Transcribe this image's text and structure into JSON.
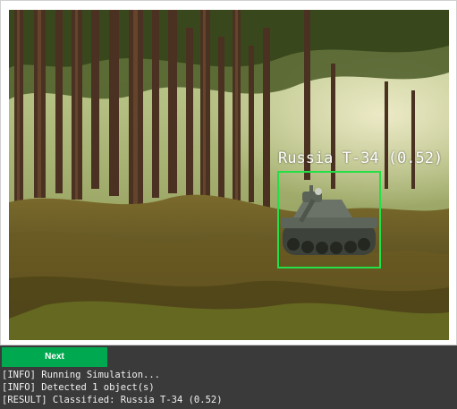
{
  "detection": {
    "label": "Russia T-34 (0.52)",
    "box_color": "#22e045"
  },
  "controls": {
    "next_label": "Next",
    "next_color": "#00a94f"
  },
  "console": {
    "lines": [
      "[INFO] Running Simulation...",
      "[INFO] Detected 1 object(s)",
      "[RESULT] Classified: Russia T-34 (0.52)"
    ]
  }
}
